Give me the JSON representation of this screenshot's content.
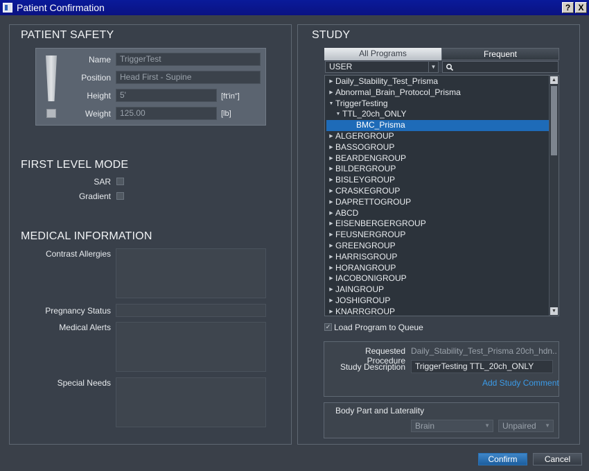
{
  "window": {
    "title": "Patient Confirmation",
    "help_label": "?",
    "close_label": "X"
  },
  "patient_safety": {
    "title": "PATIENT SAFETY",
    "name_label": "Name",
    "name_value": "TriggerTest",
    "position_label": "Position",
    "position_value": "Head First - Supine",
    "height_label": "Height",
    "height_value": "5'",
    "height_unit": "[ft'in\"]",
    "weight_label": "Weight",
    "weight_value": "125.00",
    "weight_unit": "[lb]"
  },
  "first_level_mode": {
    "title": "FIRST LEVEL MODE",
    "sar_label": "SAR",
    "gradient_label": "Gradient"
  },
  "medical_information": {
    "title": "MEDICAL INFORMATION",
    "contrast_allergies_label": "Contrast Allergies",
    "pregnancy_status_label": "Pregnancy Status",
    "medical_alerts_label": "Medical Alerts",
    "special_needs_label": "Special Needs"
  },
  "study": {
    "title": "STUDY",
    "tabs": [
      {
        "label": "All Programs",
        "active": true
      },
      {
        "label": "Frequent",
        "active": false
      }
    ],
    "filter_value": "USER",
    "tree_items": [
      {
        "label": "Daily_Stability_Test_Prisma",
        "level": 0,
        "state": "collapsed"
      },
      {
        "label": "Abnormal_Brain_Protocol_Prisma",
        "level": 0,
        "state": "collapsed"
      },
      {
        "label": "TriggerTesting",
        "level": 0,
        "state": "expanded"
      },
      {
        "label": "TTL_20ch_ONLY",
        "level": 1,
        "state": "expanded"
      },
      {
        "label": "BMC_Prisma",
        "level": 2,
        "state": "leaf",
        "selected": true
      },
      {
        "label": "ALGERGROUP",
        "level": 0,
        "state": "collapsed"
      },
      {
        "label": "BASSOGROUP",
        "level": 0,
        "state": "collapsed"
      },
      {
        "label": "BEARDENGROUP",
        "level": 0,
        "state": "collapsed"
      },
      {
        "label": "BILDERGROUP",
        "level": 0,
        "state": "collapsed"
      },
      {
        "label": "BISLEYGROUP",
        "level": 0,
        "state": "collapsed"
      },
      {
        "label": "CRASKEGROUP",
        "level": 0,
        "state": "collapsed"
      },
      {
        "label": "DAPRETTOGROUP",
        "level": 0,
        "state": "collapsed"
      },
      {
        "label": "ABCD",
        "level": 0,
        "state": "collapsed"
      },
      {
        "label": "EISENBERGERGROUP",
        "level": 0,
        "state": "collapsed"
      },
      {
        "label": "FEUSNERGROUP",
        "level": 0,
        "state": "collapsed"
      },
      {
        "label": "GREENGROUP",
        "level": 0,
        "state": "collapsed"
      },
      {
        "label": "HARRISGROUP",
        "level": 0,
        "state": "collapsed"
      },
      {
        "label": "HORANGROUP",
        "level": 0,
        "state": "collapsed"
      },
      {
        "label": "IACOBONIGROUP",
        "level": 0,
        "state": "collapsed"
      },
      {
        "label": "JAINGROUP",
        "level": 0,
        "state": "collapsed"
      },
      {
        "label": "JOSHIGROUP",
        "level": 0,
        "state": "collapsed"
      },
      {
        "label": "KNARRGROUP",
        "level": 0,
        "state": "collapsed"
      }
    ],
    "load_to_queue_label": "Load Program to Queue",
    "load_to_queue_checked": true,
    "checkmark": "✓",
    "requested_procedure_label": "Requested Procedure",
    "requested_procedure_value": "Daily_Stability_Test_Prisma 20ch_hdn...",
    "study_description_label": "Study Description",
    "study_description_value": "TriggerTesting TTL_20ch_ONLY",
    "add_comment_label": "Add Study Comment",
    "body_part_title": "Body Part and Laterality",
    "body_part_value": "Brain",
    "laterality_value": "Unpaired"
  },
  "footer": {
    "confirm_label": "Confirm",
    "cancel_label": "Cancel"
  },
  "colors": {
    "background": "#3a4049",
    "titlebar": "#0a1a9a",
    "selection": "#1e6bb8",
    "link": "#3b9be8",
    "confirm_button": "#2a71b4"
  }
}
